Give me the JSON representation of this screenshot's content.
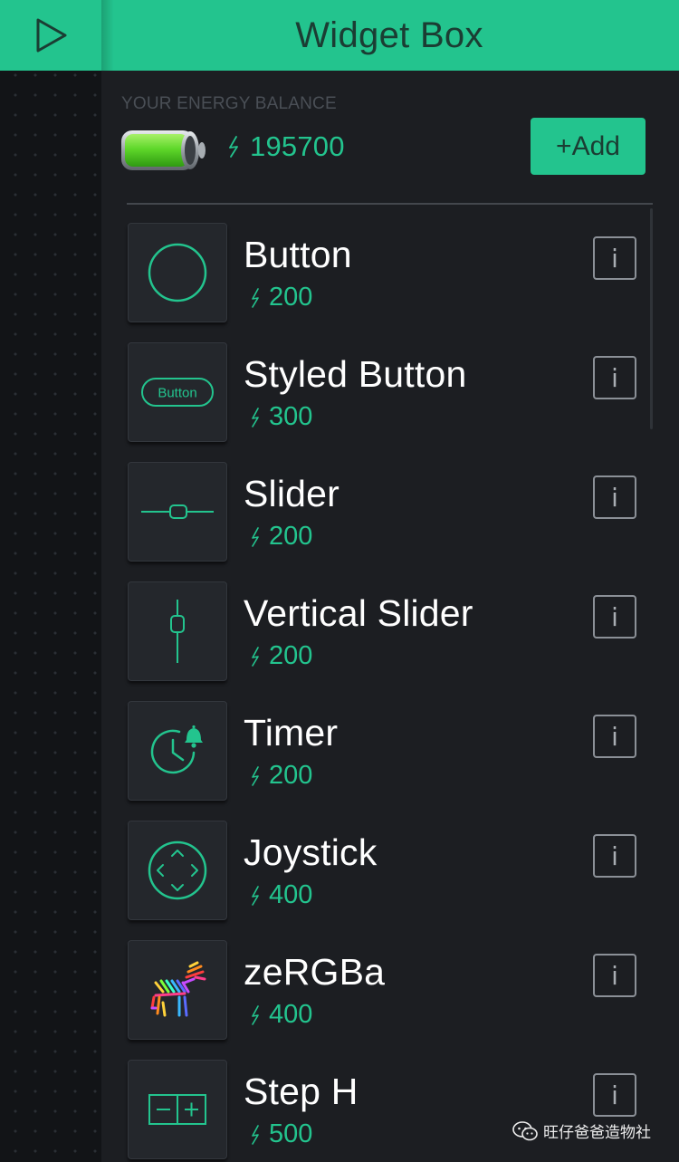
{
  "header": {
    "title": "Widget Box",
    "play_icon": "play-icon"
  },
  "energy": {
    "caption": "YOUR ENERGY BALANCE",
    "balance": "195700",
    "battery_icon": "battery-icon",
    "bolt_icon": "bolt-icon",
    "add_label": "+Add"
  },
  "colors": {
    "accent": "#23c48e",
    "background": "#1c1e22",
    "tile": "#24272c",
    "header_text": "#1b3d33"
  },
  "widgets": [
    {
      "name": "Button",
      "cost": "200",
      "icon": "circle-button-icon",
      "info_label": "i"
    },
    {
      "name": "Styled Button",
      "cost": "300",
      "icon": "styled-button-icon",
      "icon_label": "Button",
      "info_label": "i"
    },
    {
      "name": "Slider",
      "cost": "200",
      "icon": "slider-icon",
      "info_label": "i"
    },
    {
      "name": "Vertical Slider",
      "cost": "200",
      "icon": "vertical-slider-icon",
      "info_label": "i"
    },
    {
      "name": "Timer",
      "cost": "200",
      "icon": "timer-icon",
      "info_label": "i"
    },
    {
      "name": "Joystick",
      "cost": "400",
      "icon": "joystick-icon",
      "info_label": "i"
    },
    {
      "name": "zeRGBa",
      "cost": "400",
      "icon": "zebra-icon",
      "info_label": "i"
    },
    {
      "name": "Step H",
      "cost": "500",
      "icon": "step-h-icon",
      "info_label": "i"
    }
  ],
  "watermark": {
    "text": "旺仔爸爸造物社",
    "icon": "wechat-icon"
  }
}
